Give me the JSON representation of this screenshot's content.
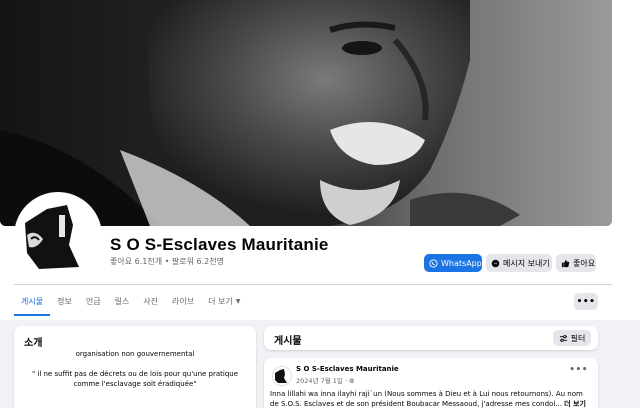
{
  "page": {
    "name": "S O S-Esclaves Mauritanie",
    "stats": "좋아요 6.1천개 • 팔로워 6.2천명"
  },
  "actions": {
    "whatsapp": "WhatsApp",
    "message": "메시지 보내기",
    "like": "좋아요",
    "more": "•••"
  },
  "tabs": [
    {
      "label": "게시물"
    },
    {
      "label": "정보"
    },
    {
      "label": "언급"
    },
    {
      "label": "릴스"
    },
    {
      "label": "사진"
    },
    {
      "label": "라이브"
    },
    {
      "label": "더 보기"
    }
  ],
  "intro": {
    "title": "소개",
    "category": "organisation non gouvernemental",
    "quote": "\" il ne suffit pas de décrets ou de lois pour qu'une pratique comme l'esclavage soit éradiquée\""
  },
  "posts_section": {
    "title": "게시물",
    "filter": "필터"
  },
  "post": {
    "author": "S O S-Esclaves Mauritanie",
    "date": "2024년 7월 1일 · ",
    "text": "Inna lillahi wa inna ilayhi raji`un (Nous sommes à Dieu et à Lui nous retournons). Au nom de S.O.S. Esclaves et de son président Boubacar Messaoud, j'adresse mes condol... ",
    "see_more": "더 보기",
    "menu": "•••"
  },
  "colors": {
    "accent": "#1b74e4",
    "background": "#f0f2f5",
    "secondary_button": "#e4e6eb"
  }
}
